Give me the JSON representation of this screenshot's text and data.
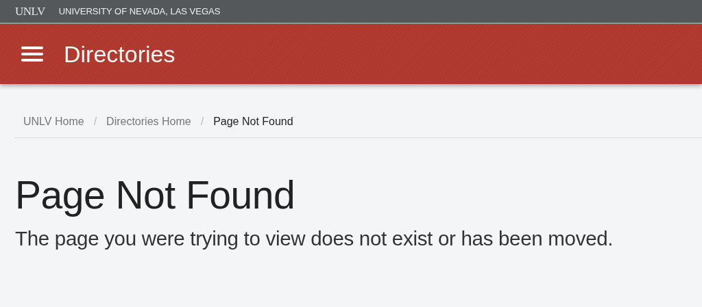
{
  "top_bar": {
    "logo": "UNLV",
    "title": "UNIVERSITY OF NEVADA, LAS VEGAS"
  },
  "header": {
    "title": "Directories"
  },
  "breadcrumb": {
    "items": [
      {
        "label": "UNLV Home",
        "current": false
      },
      {
        "label": "Directories Home",
        "current": false
      },
      {
        "label": "Page Not Found",
        "current": true
      }
    ],
    "separators": [
      "/",
      "/"
    ]
  },
  "heading": "Page Not Found",
  "message": "The page you were trying to view does not exist or has been moved."
}
